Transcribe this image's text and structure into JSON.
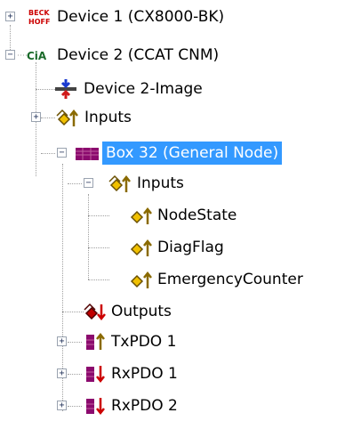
{
  "tree": {
    "device1": {
      "label": "Device 1 (CX8000-BK)",
      "icon": "beckhoff-logo-icon",
      "icon_text": "BECK\nHOFF"
    },
    "device2": {
      "label": "Device 2 (CCAT CNM)",
      "icon": "cia-logo-icon",
      "icon_text": "CiA"
    },
    "device2_image": {
      "label": "Device 2-Image",
      "icon": "process-image-icon"
    },
    "device2_inputs": {
      "label": "Inputs",
      "icon": "inputs-icon"
    },
    "box32": {
      "label": "Box 32 (General Node)",
      "icon": "box-node-icon"
    },
    "box32_inputs": {
      "label": "Inputs",
      "icon": "inputs-icon"
    },
    "node_state": {
      "label": "NodeState",
      "icon": "input-variable-icon"
    },
    "diag_flag": {
      "label": "DiagFlag",
      "icon": "input-variable-icon"
    },
    "emergency_counter": {
      "label": "EmergencyCounter",
      "icon": "input-variable-icon"
    },
    "box32_outputs": {
      "label": "Outputs",
      "icon": "outputs-icon"
    },
    "txpdo1": {
      "label": "TxPDO 1",
      "icon": "txpdo-icon"
    },
    "rxpdo1": {
      "label": "RxPDO 1",
      "icon": "rxpdo-icon"
    },
    "rxpdo2": {
      "label": "RxPDO 2",
      "icon": "rxpdo-icon"
    }
  },
  "colors": {
    "selection": "#3399ff",
    "input_arrow": "#8a6a00",
    "output_arrow": "#cc0000",
    "box": "#8b0a6e"
  }
}
